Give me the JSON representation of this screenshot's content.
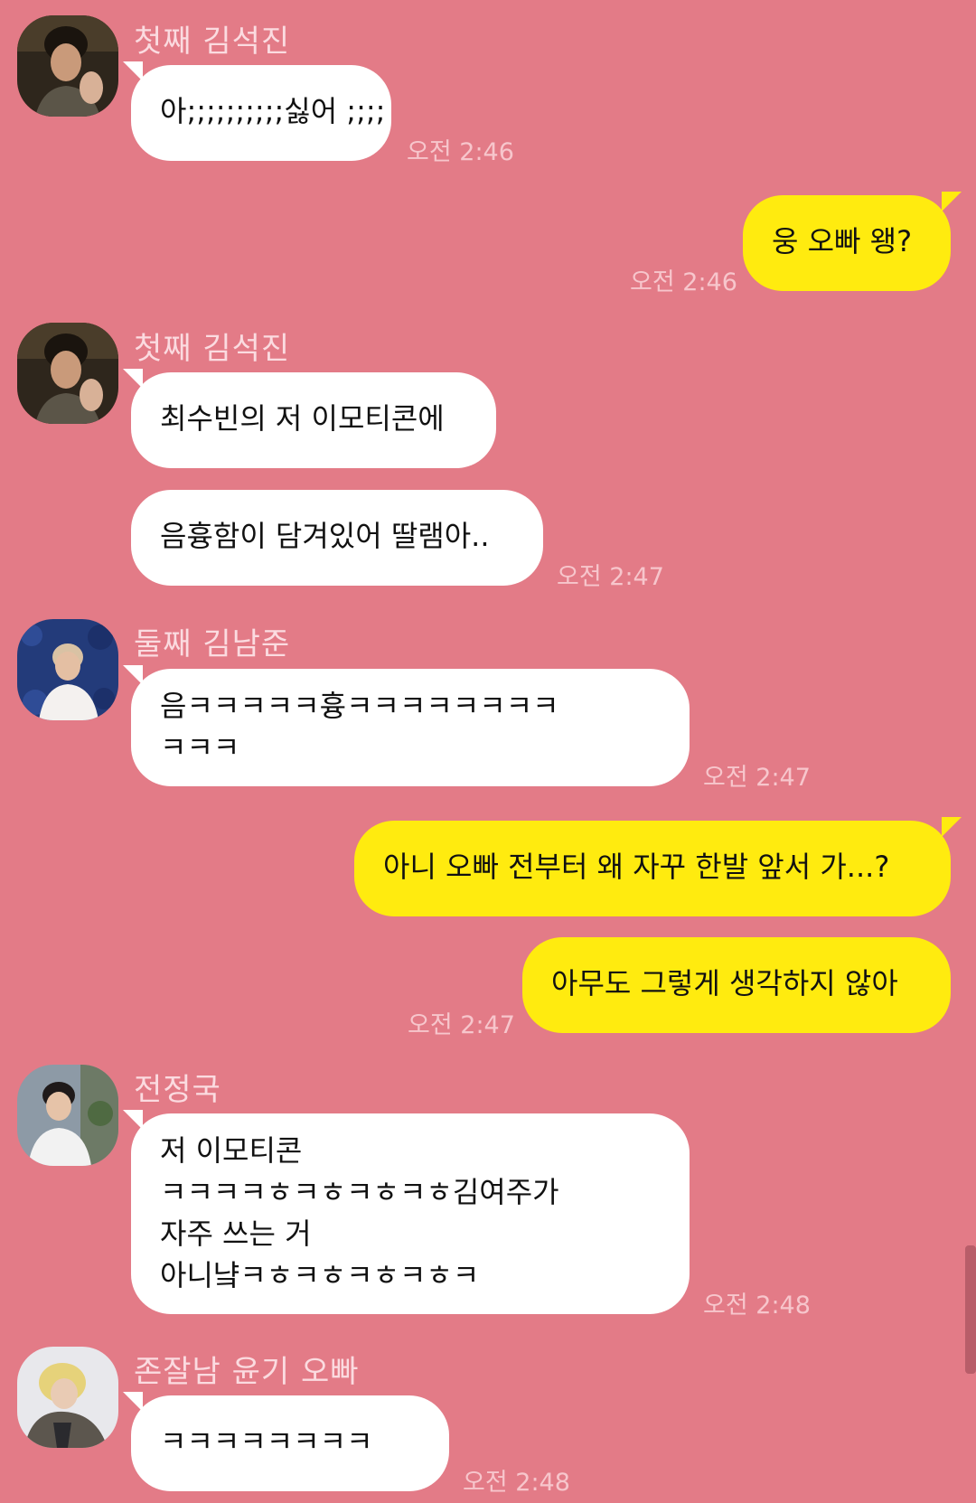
{
  "colors": {
    "background": "#e37b87",
    "incoming_bubble": "#ffffff",
    "outgoing_bubble": "#ffeb0f",
    "name_text": "#fbdbe0",
    "time_text": "#f7c6cc"
  },
  "messages": [
    {
      "sender": "첫째 김석진",
      "time": "오전 2:46",
      "bubbles": [
        {
          "lines": [
            "아;;;;;;;;;;싫어 ;;;;"
          ]
        }
      ]
    },
    {
      "time": "오전 2:46",
      "bubbles": [
        {
          "lines": [
            "웅 오빠 왱?"
          ]
        }
      ]
    },
    {
      "sender": "첫째 김석진",
      "time": "오전 2:47",
      "bubbles": [
        {
          "lines": [
            "최수빈의 저 이모티콘에"
          ]
        },
        {
          "lines": [
            "음흉함이 담겨있어 딸램아.."
          ]
        }
      ]
    },
    {
      "sender": "둘째 김남준",
      "time": "오전 2:47",
      "bubbles": [
        {
          "lines": [
            "음ㅋㅋㅋㅋㅋ흉ㅋㅋㅋㅋㅋㅋㅋㅋ",
            "ㅋㅋㅋ"
          ]
        }
      ]
    },
    {
      "time": "오전 2:47",
      "bubbles": [
        {
          "lines": [
            "아니 오빠 전부터 왜 자꾸 한발 앞서 가...?"
          ]
        },
        {
          "lines": [
            "아무도 그렇게 생각하지 않아"
          ]
        }
      ]
    },
    {
      "sender": "전정국",
      "time": "오전 2:48",
      "bubbles": [
        {
          "lines": [
            "저 이모티콘",
            "ㅋㅋㅋㅋㅎㅋㅎㅋㅎㅋㅎ김여주가",
            "자주 쓰는 거",
            "아니냨ㅋㅎㅋㅎㅋㅎㅋㅎㅋ"
          ]
        }
      ]
    },
    {
      "sender": "존잘남 윤기 오빠",
      "time": "오전 2:48",
      "bubbles": [
        {
          "lines": [
            "ㅋㅋㅋㅋㅋㅋㅋㅋ"
          ]
        }
      ]
    }
  ]
}
